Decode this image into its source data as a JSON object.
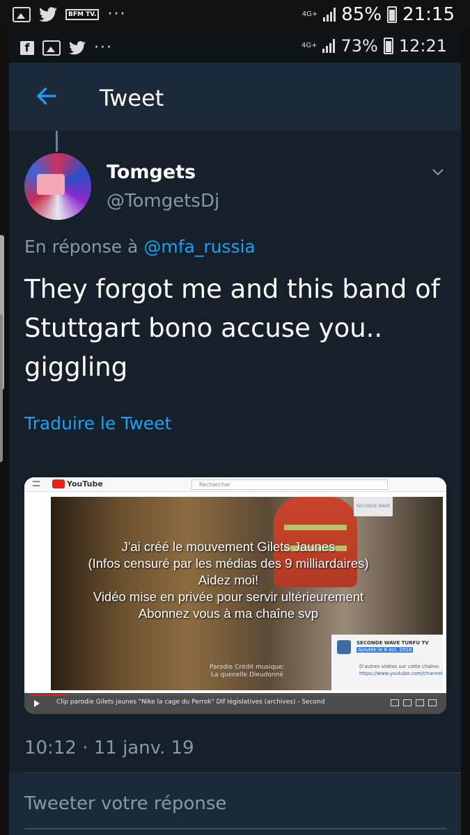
{
  "outer_status": {
    "icons": [
      "gallery-icon",
      "twitter-icon",
      "bfm-tv-icon",
      "more-dots-icon"
    ],
    "bfm_text": "BFM TV.",
    "network": "4G+",
    "battery": "85%",
    "time": "21:15"
  },
  "inner_status": {
    "icons": [
      "facebook-icon",
      "gallery-icon",
      "twitter-icon",
      "more-dots-icon"
    ],
    "network": "4G+",
    "battery": "73%",
    "time": "12:21"
  },
  "appbar": {
    "back_icon": "arrow-left-icon",
    "title": "Tweet"
  },
  "tweet": {
    "author_name": "Tomgets",
    "author_handle": "@TomgetsDj",
    "reply_prefix": "En réponse à",
    "reply_mention": "@mfa_russia",
    "text": "They forgot me and this band of Stuttgart bono accuse you.. giggling",
    "translate_label": "Traduire le Tweet",
    "timestamp": "10:12 · 11 janv. 19"
  },
  "media": {
    "site": "YouTube",
    "search_placeholder": "Rechercher",
    "overlay_lines": [
      "J'ai créé le mouvement Gilets Jaunes",
      "(Infos censuré par les médias des 9 milliardaires)",
      "Aidez moi!",
      "Vidéo mise en privée pour servir ultérieurement",
      "Abonnez vous à ma chaîne svp"
    ],
    "credit_line1": "Parodie Crédit musique:",
    "credit_line2": "La quenelle Dieudonné",
    "channel_name": "SECONDE WAVE TURFU TV",
    "channel_sub": "Ajoutée le 6 oct. 2018",
    "more_videos": "D'autres vidéos sur cette chaîne:",
    "video_title": "Clip parodie Gilets jaunes \"Nike la cage du Perrok\" DIf législatives (archives) - Second",
    "progress": 0.09
  },
  "reply_box": {
    "placeholder": "Tweeter votre réponse"
  }
}
